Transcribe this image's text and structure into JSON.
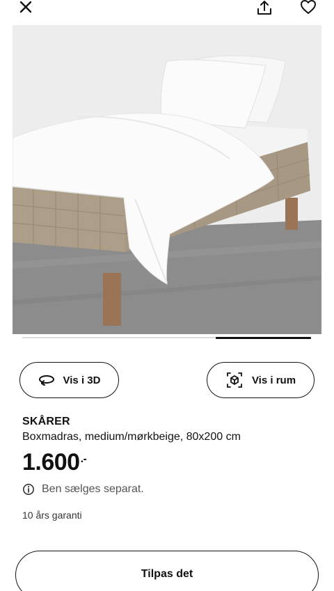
{
  "header": {
    "close_icon": "close-icon",
    "share_icon": "share-icon",
    "favorite_icon": "heart-icon"
  },
  "gallery": {
    "image_alt": "bed-product-photo",
    "carousel_progress": 0.67
  },
  "actions": {
    "view_3d_label": "Vis i 3D",
    "view_3d_icon": "rotate-3d-icon",
    "view_room_label": "Vis i rum",
    "view_room_icon": "ar-cube-icon"
  },
  "product": {
    "name": "SKÅRER",
    "description": "Boxmadras, medium/mørkbeige, 80x200 cm",
    "price": "1.600",
    "price_suffix": ".-",
    "notice_icon": "info-icon",
    "notice": "Ben sælges separat.",
    "warranty": "10 års garanti"
  },
  "cta": {
    "label": "Tilpas det"
  },
  "colors": {
    "text": "#111111",
    "muted": "#555555",
    "border": "#111111",
    "bed_fabric": "#a89a85",
    "background": "#ffffff"
  }
}
